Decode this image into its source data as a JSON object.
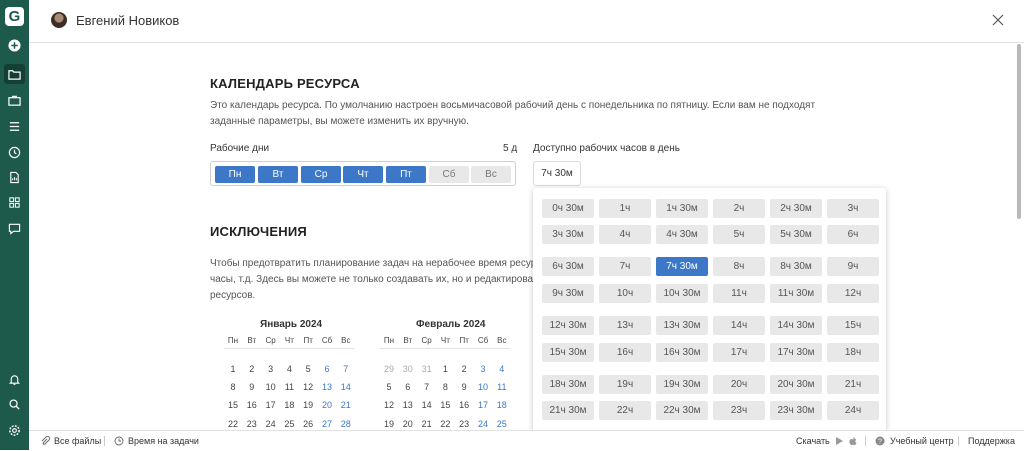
{
  "sidebar": {
    "logo": "G",
    "items": [
      {
        "icon": "plus-circle-icon"
      },
      {
        "icon": "folder-icon",
        "active": true
      },
      {
        "icon": "briefcase-icon"
      },
      {
        "icon": "list-icon"
      },
      {
        "icon": "clock-icon"
      },
      {
        "icon": "document-chart-icon"
      },
      {
        "icon": "grid-icon"
      },
      {
        "icon": "chat-icon"
      },
      {
        "icon": "bell-icon"
      },
      {
        "icon": "search-icon"
      },
      {
        "icon": "gear-icon"
      }
    ]
  },
  "header": {
    "user_name": "Евгений Новиков"
  },
  "calendar": {
    "title": "КАЛЕНДАРЬ РЕСУРСА",
    "description_line1": "Это календарь ресурса. По умолчанию настроен восьмичасовой рабочий день с понедельника по пятницу. Если вам не подходят",
    "description_line2": "заданные параметры, вы можете изменить их вручную.",
    "work_days_label": "Рабочие дни",
    "work_days_count": "5 д",
    "days": [
      {
        "label": "Пн",
        "on": true
      },
      {
        "label": "Вт",
        "on": true
      },
      {
        "label": "Ср",
        "on": true
      },
      {
        "label": "Чт",
        "on": true
      },
      {
        "label": "Пт",
        "on": true
      },
      {
        "label": "Сб",
        "on": false
      },
      {
        "label": "Вс",
        "on": false
      }
    ],
    "hours_label": "Доступно рабочих часов в день",
    "hours_value": "7ч 30м"
  },
  "hours_options": [
    "0ч 30м",
    "1ч",
    "1ч 30м",
    "2ч",
    "2ч 30м",
    "3ч",
    "3ч 30м",
    "4ч",
    "4ч 30м",
    "5ч",
    "5ч 30м",
    "6ч",
    "6ч 30м",
    "7ч",
    "7ч 30м",
    "8ч",
    "8ч 30м",
    "9ч",
    "9ч 30м",
    "10ч",
    "10ч 30м",
    "11ч",
    "11ч 30м",
    "12ч",
    "12ч 30м",
    "13ч",
    "13ч 30м",
    "14ч",
    "14ч 30м",
    "15ч",
    "15ч 30м",
    "16ч",
    "16ч 30м",
    "17ч",
    "17ч 30м",
    "18ч",
    "18ч 30м",
    "19ч",
    "19ч 30м",
    "20ч",
    "20ч 30м",
    "21ч",
    "21ч 30м",
    "22ч",
    "22ч 30м",
    "23ч",
    "23ч 30м",
    "24ч"
  ],
  "hours_selected": "7ч 30м",
  "exceptions": {
    "title": "ИСКЛЮЧЕНИЯ",
    "line1": "Чтобы предотвратить планирование задач на нерабочее время ресурс",
    "line2": "часы, т.д. Здесь вы можете не только создавать их, но и редактироват",
    "line3": "ресурсов."
  },
  "weekday_headers": [
    "Пн",
    "Вт",
    "Ср",
    "Чт",
    "Пт",
    "Сб",
    "Вс"
  ],
  "months": [
    {
      "title": "Январь 2024",
      "rows": [
        [
          {
            "d": "1"
          },
          {
            "d": "2"
          },
          {
            "d": "3"
          },
          {
            "d": "4"
          },
          {
            "d": "5"
          },
          {
            "d": "6",
            "we": true
          },
          {
            "d": "7",
            "we": true
          }
        ],
        [
          {
            "d": "8"
          },
          {
            "d": "9"
          },
          {
            "d": "10"
          },
          {
            "d": "11"
          },
          {
            "d": "12"
          },
          {
            "d": "13",
            "we": true
          },
          {
            "d": "14",
            "we": true
          }
        ],
        [
          {
            "d": "15"
          },
          {
            "d": "16"
          },
          {
            "d": "17"
          },
          {
            "d": "18"
          },
          {
            "d": "19"
          },
          {
            "d": "20",
            "we": true
          },
          {
            "d": "21",
            "we": true
          }
        ],
        [
          {
            "d": "22"
          },
          {
            "d": "23"
          },
          {
            "d": "24"
          },
          {
            "d": "25"
          },
          {
            "d": "26"
          },
          {
            "d": "27",
            "we": true
          },
          {
            "d": "28",
            "we": true
          }
        ]
      ]
    },
    {
      "title": "Февраль 2024",
      "rows": [
        [
          {
            "d": "29",
            "prev": true
          },
          {
            "d": "30",
            "prev": true
          },
          {
            "d": "31",
            "prev": true
          },
          {
            "d": "1"
          },
          {
            "d": "2"
          },
          {
            "d": "3",
            "we": true
          },
          {
            "d": "4",
            "we": true
          }
        ],
        [
          {
            "d": "5"
          },
          {
            "d": "6"
          },
          {
            "d": "7"
          },
          {
            "d": "8"
          },
          {
            "d": "9"
          },
          {
            "d": "10",
            "we": true
          },
          {
            "d": "11",
            "we": true
          }
        ],
        [
          {
            "d": "12"
          },
          {
            "d": "13"
          },
          {
            "d": "14"
          },
          {
            "d": "15"
          },
          {
            "d": "16"
          },
          {
            "d": "17",
            "we": true
          },
          {
            "d": "18",
            "we": true
          }
        ],
        [
          {
            "d": "19"
          },
          {
            "d": "20"
          },
          {
            "d": "21"
          },
          {
            "d": "22"
          },
          {
            "d": "23"
          },
          {
            "d": "24",
            "we": true
          },
          {
            "d": "25",
            "we": true
          }
        ]
      ]
    }
  ],
  "footer": {
    "all_files": "Все файлы",
    "time_on_tasks": "Время на задачи",
    "download": "Скачать",
    "learning_center": "Учебный центр",
    "support": "Поддержка"
  },
  "colors": {
    "accent": "#3c78c7",
    "sidebar": "#1e5a4c"
  }
}
